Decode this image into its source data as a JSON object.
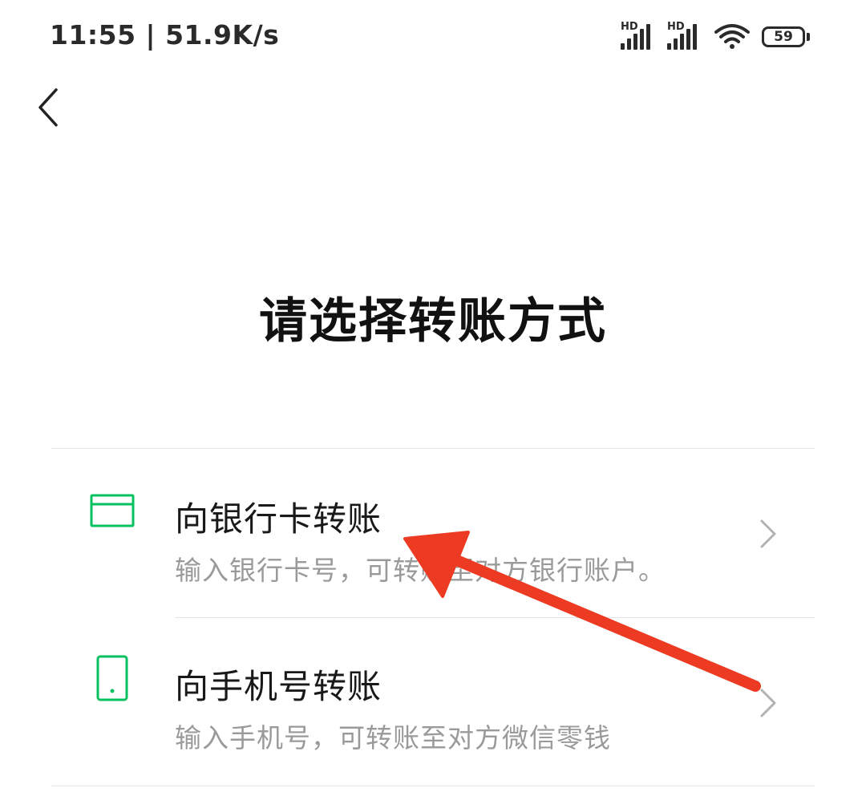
{
  "status_bar": {
    "time_speed": "11:55 | 51.9K/s",
    "signal1_label": "HD",
    "signal2_label": "HD",
    "battery": "59"
  },
  "header": {
    "back_icon": "chevron-left-icon"
  },
  "title": "请选择转账方式",
  "options": [
    {
      "icon": "bank-card-icon",
      "title": "向银行卡转账",
      "desc": "输入银行卡号，可转账至对方银行账户。"
    },
    {
      "icon": "mobile-phone-icon",
      "title": "向手机号转账",
      "desc": "输入手机号，可转账至对方微信零钱"
    }
  ],
  "colors": {
    "accent_green": "#07c160",
    "annotation_red": "#ec3b22"
  }
}
